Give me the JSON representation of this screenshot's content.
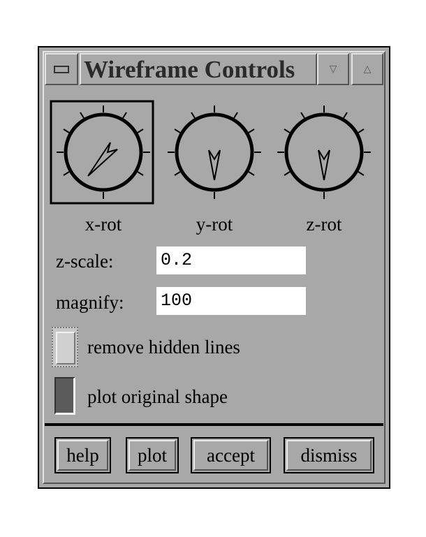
{
  "window": {
    "title": "Wireframe Controls"
  },
  "titlebar": {
    "menu_icon": "window-menu-icon",
    "minimize_glyph": "▽",
    "maximize_glyph": "△"
  },
  "dials": [
    {
      "label": "x-rot",
      "selected": true
    },
    {
      "label": "y-rot",
      "selected": false
    },
    {
      "label": "z-rot",
      "selected": false
    }
  ],
  "fields": {
    "z_scale_label": "z-scale:",
    "z_scale_value": "0.2",
    "magnify_label": "magnify:",
    "magnify_value": "100"
  },
  "options": {
    "remove_hidden_lines_label": "remove hidden lines",
    "remove_hidden_lines_checked": false,
    "plot_original_shape_label": "plot original shape",
    "plot_original_shape_checked": true
  },
  "buttons": {
    "help": "help",
    "plot": "plot",
    "accept": "accept",
    "dismiss": "dismiss"
  },
  "colors": {
    "background": "#a8a8a8",
    "field_background": "#ffffff",
    "toggle_on": "#5a5a5a",
    "toggle_off": "#d0d0d0"
  }
}
